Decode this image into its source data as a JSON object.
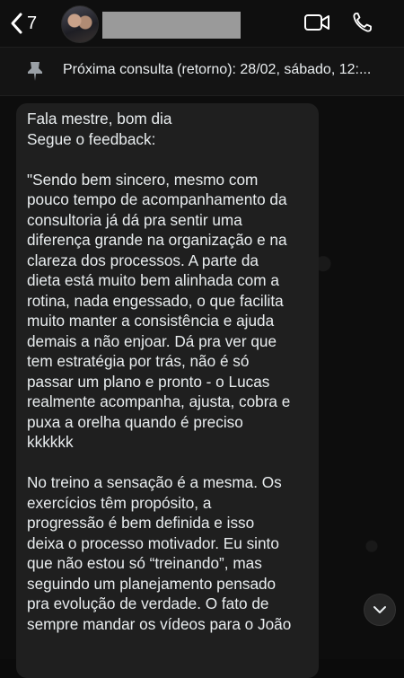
{
  "header": {
    "back_count": "7",
    "contact_name": ""
  },
  "pinned": {
    "text": "Próxima consulta (retorno): 28/02, sábado, 12:..."
  },
  "message": {
    "lines_1": [
      "Fala mestre, bom dia",
      "Segue o feedback:"
    ],
    "lines_2": [
      "\"Sendo bem sincero, mesmo com",
      "pouco tempo de acompanhamento da",
      "consultoria já dá pra sentir uma",
      "diferença grande na organização e na",
      "clareza dos processos. A parte da",
      "dieta está muito bem alinhada com a",
      "rotina, nada engessado, o que facilita",
      "muito manter a consistência e ajuda",
      "demais a não enjoar. Dá pra ver que",
      "tem estratégia por trás, não é só",
      "passar um plano e pronto - o Lucas",
      "realmente acompanha, ajusta, cobra e",
      "puxa a orelha quando é preciso",
      "kkkkkk"
    ],
    "lines_3": [
      "No treino a sensação é a mesma. Os",
      "exercícios têm propósito, a",
      "progressão é bem definida e isso",
      "deixa o processo motivador. Eu sinto",
      "que não estou só “treinando”, mas",
      "seguindo um planejamento pensado",
      "pra evolução de verdade. O fato de",
      "sempre mandar os vídeos para o João"
    ]
  },
  "icons": {
    "back": "chevron-left-icon",
    "video": "video-camera-icon",
    "call": "phone-icon",
    "pin": "pin-icon",
    "scroll": "chevron-down-icon"
  },
  "colors": {
    "background": "#0b0b0b",
    "bubble": "#1f1f1f",
    "text": "#e9edef"
  }
}
